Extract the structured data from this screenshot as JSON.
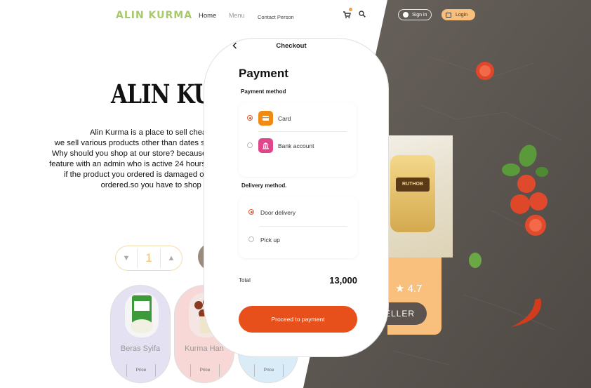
{
  "header": {
    "logo": "ALIN KURMA",
    "nav": {
      "home": "Home",
      "menu": "Menu",
      "contact": "Contact Person"
    },
    "sign_in": "Sign in",
    "login": "Login"
  },
  "hero": {
    "title": "ALIN KUR",
    "lines": [
      "Alin Kurma is a place to sell cheap a",
      "we sell various products other than dates such",
      "Why should you shop at our store? because ou",
      "feature with an admin who is active 24 hours. W",
      "if the product you ordered is damaged or do",
      "ordered.so you have to shop with"
    ]
  },
  "stepper": {
    "value": "1"
  },
  "products": [
    {
      "name": "Beras Syifa",
      "price_label": "Price",
      "color": "#e4e2f2"
    },
    {
      "name": "Kurma Han",
      "price_label": "Price",
      "color": "#f7d8d7"
    },
    {
      "name": "",
      "price_label": "Price",
      "color": "#d9ecf8"
    }
  ],
  "side_panel": {
    "rating": "4.7",
    "seller_label": "ELLER",
    "package_label": "RUTHOB"
  },
  "checkout": {
    "header": "Checkout",
    "title": "Payment",
    "payment_method_label": "Payment method",
    "payment_options": [
      {
        "label": "Card",
        "selected": true,
        "icon": "card-icon",
        "color": "#f08a12"
      },
      {
        "label": "Bank account",
        "selected": false,
        "icon": "bank-icon",
        "color": "#e0478a"
      }
    ],
    "delivery_method_label": "Delivery method.",
    "delivery_options": [
      {
        "label": "Door delivery",
        "selected": true
      },
      {
        "label": "Pick up",
        "selected": false
      }
    ],
    "total_label": "Total",
    "total_value": "13,000",
    "proceed_label": "Proceed to payment"
  },
  "colors": {
    "accent": "#e8501b",
    "logo": "#a7c96a",
    "login": "#f8be7c",
    "panel": "#f9c07d"
  }
}
